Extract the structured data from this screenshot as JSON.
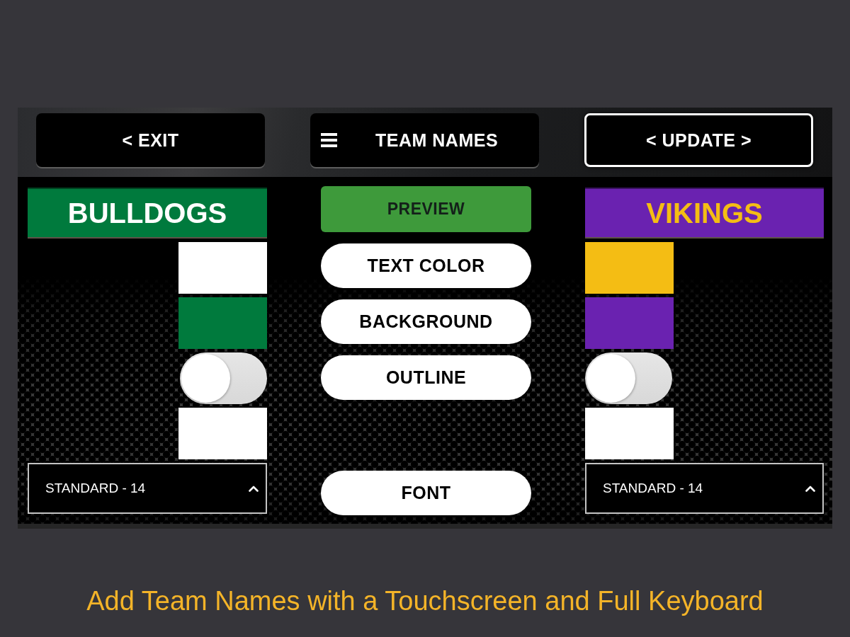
{
  "top_bar": {
    "buttons": [
      {
        "label": "< EXIT",
        "kind": "plain"
      },
      {
        "label": "TEAM NAMES",
        "kind": "menu"
      },
      {
        "label": "< UPDATE >",
        "kind": "outlined"
      }
    ]
  },
  "teams": [
    {
      "name": "BULLDOGS",
      "settings": [
        {
          "kind": "text",
          "color": "#ffffff"
        },
        {
          "kind": "background",
          "color": "#007a3d"
        },
        {
          "kind": "toggle",
          "on": false
        },
        {
          "kind": "outline",
          "color": "#ffffff"
        }
      ],
      "font": "STANDARD - 14"
    },
    {
      "name": "VIKINGS",
      "settings": [
        {
          "kind": "text",
          "color": "#f4bd14"
        },
        {
          "kind": "background",
          "color": "#6a22b0"
        },
        {
          "kind": "toggle",
          "on": false
        },
        {
          "kind": "outline",
          "color": "#ffffff"
        }
      ],
      "font": "STANDARD - 14"
    }
  ],
  "controls": [
    {
      "label": "PREVIEW",
      "kind": "preview"
    },
    {
      "label": "TEXT COLOR",
      "kind": "option"
    },
    {
      "label": "BACKGROUND",
      "kind": "option"
    },
    {
      "label": "OUTLINE",
      "kind": "option"
    },
    {
      "label": "FONT",
      "kind": "option"
    }
  ],
  "caption": "Add Team Names with a Touchscreen and Full Keyboard"
}
